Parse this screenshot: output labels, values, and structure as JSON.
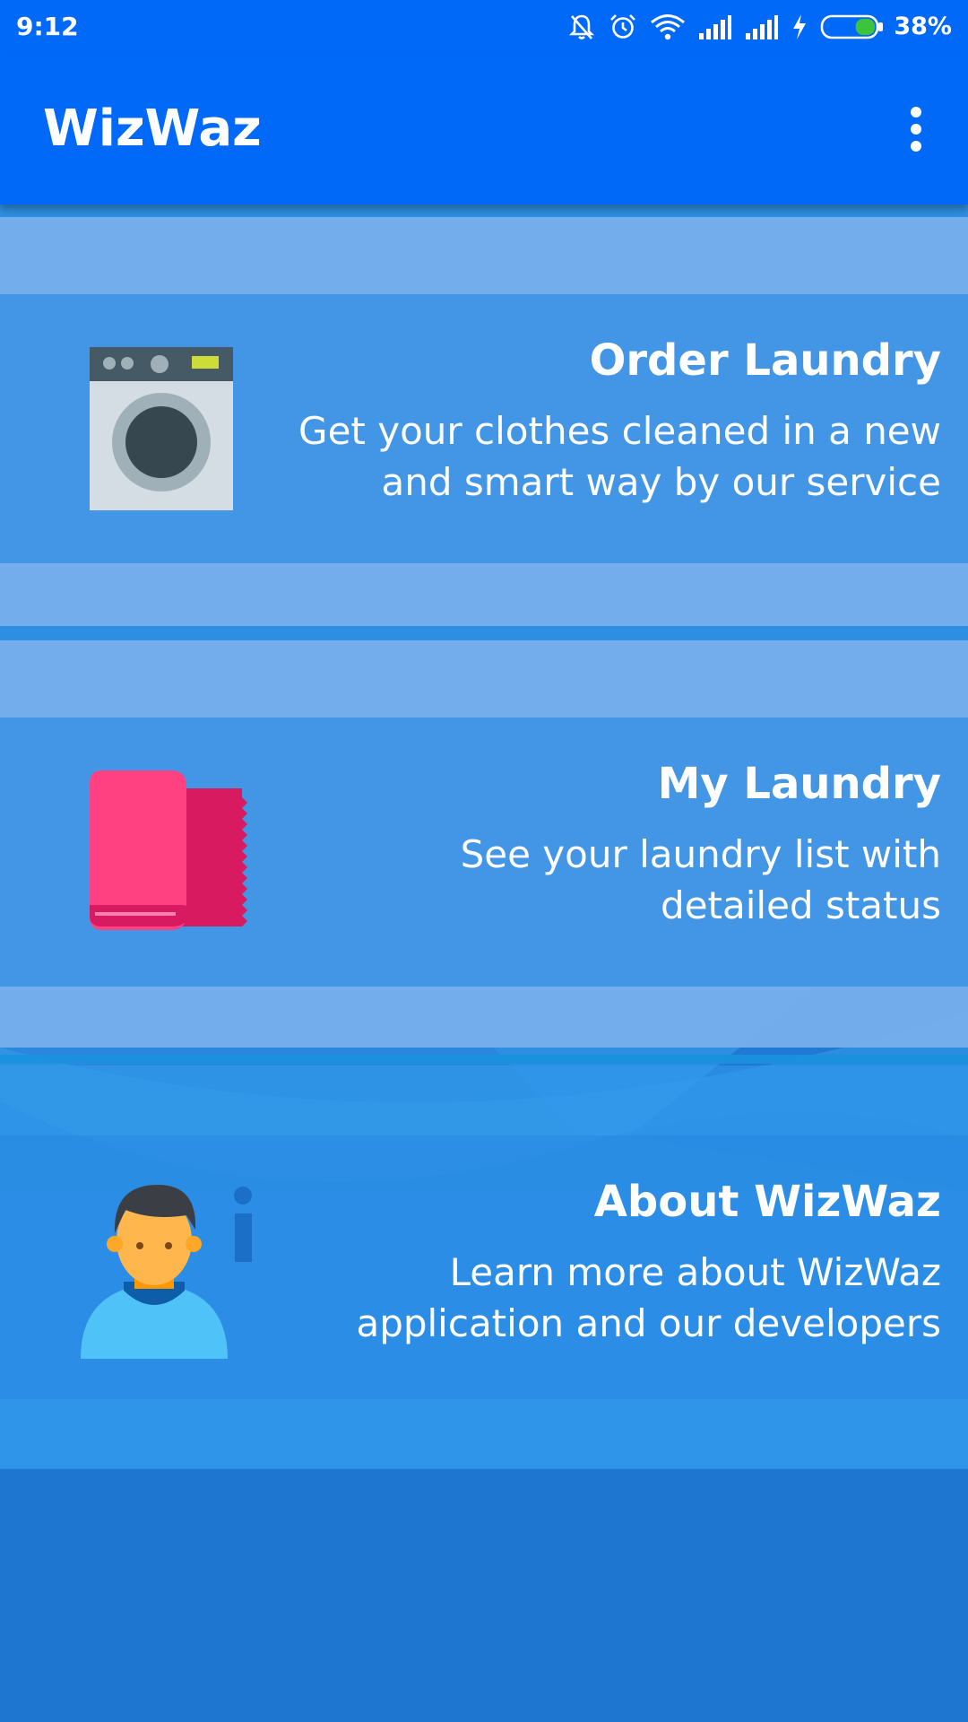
{
  "status_bar": {
    "time": "9:12",
    "battery_percent": "38%",
    "icons": [
      "notifications-off-icon",
      "alarm-icon",
      "wifi-icon",
      "signal-icon",
      "signal-icon",
      "charging-icon",
      "battery-icon"
    ],
    "battery_fill_fraction": 0.38,
    "battery_color": "#3cc43c"
  },
  "app_bar": {
    "title": "WizWaz",
    "menu_icon": "more-vert-icon",
    "color": "#0069f7"
  },
  "menu": [
    {
      "title": "Order Laundry",
      "description_lines": [
        "Get your clothes cleaned in a new",
        "and smart way by our service"
      ],
      "icon": "washing-machine-icon"
    },
    {
      "title": "My Laundry",
      "description_lines": [
        "See your laundry list with",
        "detailed status"
      ],
      "icon": "towel-icon"
    },
    {
      "title": "About WizWaz",
      "description_lines": [
        "Learn more about WizWaz",
        "application and our developers"
      ],
      "icon": "user-info-icon"
    }
  ]
}
